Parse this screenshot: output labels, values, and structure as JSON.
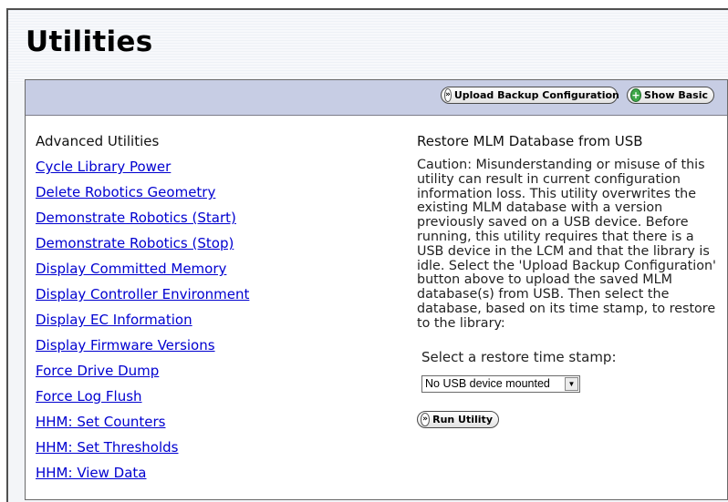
{
  "page": {
    "title": "Utilities"
  },
  "toolbar": {
    "upload_label": "Upload Backup Configuration",
    "show_basic_label": "Show Basic"
  },
  "advanced_utilities": {
    "heading": "Advanced Utilities",
    "links": [
      "Cycle Library Power",
      "Delete Robotics Geometry",
      "Demonstrate Robotics (Start)",
      "Demonstrate Robotics (Stop)",
      "Display Committed Memory",
      "Display Controller Environment",
      "Display EC Information",
      "Display Firmware Versions",
      "Force Drive Dump",
      "Force Log Flush",
      "HHM: Set Counters",
      "HHM: Set Thresholds",
      "HHM: View Data"
    ]
  },
  "restore": {
    "heading": "Restore MLM Database from USB",
    "caution": "Caution: Misunderstanding or misuse of this utility can result in current configuration information loss. This utility overwrites the existing MLM database with a version previously saved on a USB device. Before running, this utility requires that there is a USB device in the LCM and that the library is idle. Select the 'Upload Backup Configuration' button above to upload the saved MLM database(s) from USB. Then select the database, based on its time stamp, to restore to the library:",
    "select_label": "Select a restore time stamp:",
    "select_value": "No USB device mounted",
    "run_label": "Run Utility"
  },
  "icons": {
    "double_chevron": "double-chevron-right-icon",
    "plus": "plus-icon",
    "dropdown": "dropdown-arrow-icon"
  }
}
